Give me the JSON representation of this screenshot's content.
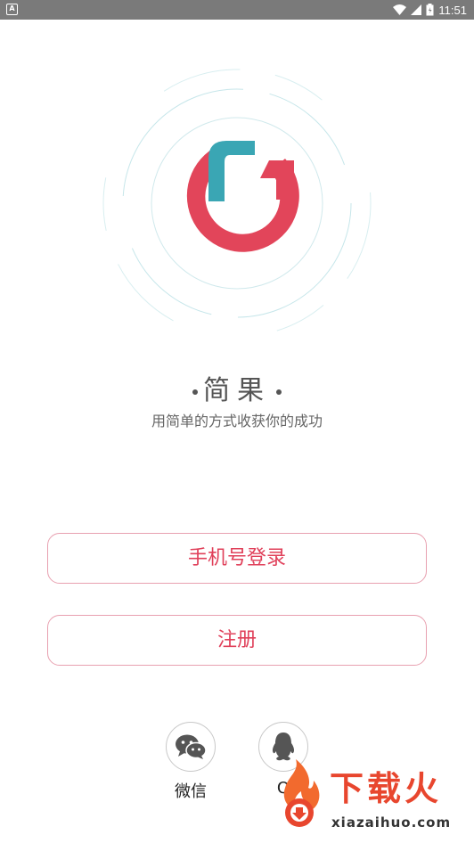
{
  "status_bar": {
    "time": "11:51",
    "left_icon": "A"
  },
  "app": {
    "name": "简果",
    "slogan": "用简单的方式收获你的成功"
  },
  "buttons": {
    "phone_login": "手机号登录",
    "register": "注册"
  },
  "social": {
    "wechat_label": "微信",
    "qq_label": "Q"
  },
  "watermark": {
    "text": "下载火",
    "domain": "xiazaihuo.com"
  },
  "colors": {
    "accent": "#e0405a",
    "logo_red": "#e2455a",
    "logo_teal": "#3aa6b4",
    "button_border": "#e8a0b0",
    "watermark_orange": "#e8462e"
  }
}
